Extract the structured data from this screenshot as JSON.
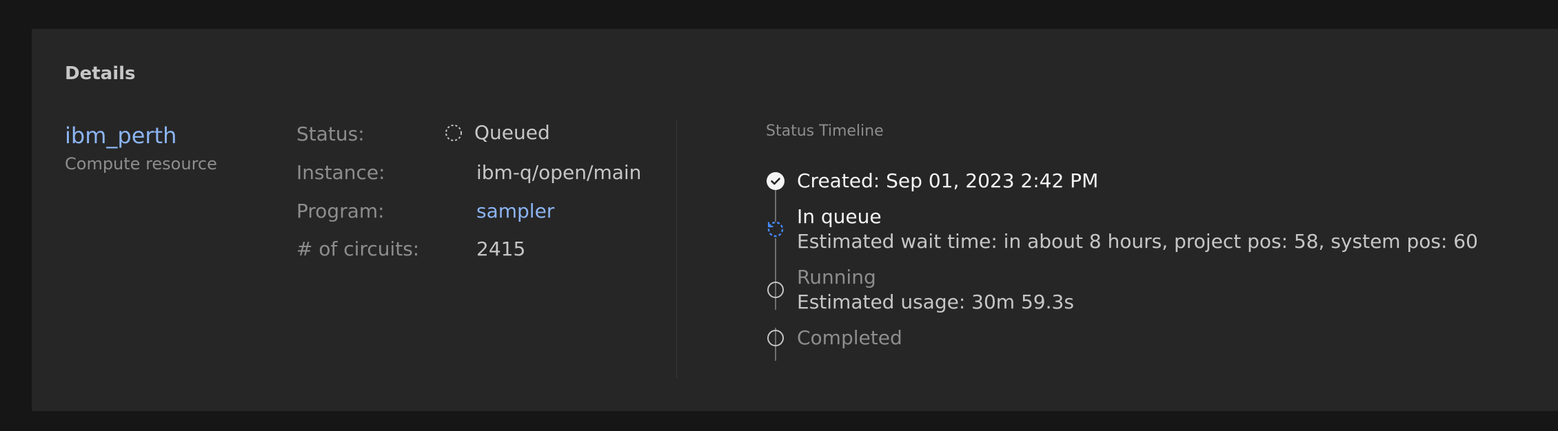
{
  "details": {
    "heading": "Details",
    "backend": {
      "name": "ibm_perth",
      "subtitle": "Compute resource"
    },
    "rows": [
      {
        "label": "Status:",
        "value": "Queued"
      },
      {
        "label": "Instance:",
        "value": "ibm-q/open/main"
      },
      {
        "label": "Program:",
        "value": "sampler"
      },
      {
        "label": "# of circuits:",
        "value": "2415"
      }
    ]
  },
  "timeline": {
    "title": "Status Timeline",
    "steps": [
      {
        "label": "Created: Sep 01, 2023 2:42 PM",
        "state": "complete",
        "icon": "checkmark-filled-icon"
      },
      {
        "label": "In queue",
        "detail": "Estimated wait time: in about 8 hours, project pos: 58, system pos: 60",
        "state": "in-progress",
        "icon": "progress-icon"
      },
      {
        "label": "Running",
        "detail": "Estimated usage: 30m 59.3s",
        "state": "pending",
        "icon": "circle-outline-icon"
      },
      {
        "label": "Completed",
        "state": "pending",
        "icon": "circle-outline-icon"
      }
    ]
  },
  "colors": {
    "background": "#161616",
    "panel": "#262626",
    "link": "#8cb4f2",
    "text_primary": "#f4f4f4",
    "text_secondary": "#c6c6c6",
    "text_muted": "#8d8d8d",
    "progress_accent": "#4589ff"
  }
}
